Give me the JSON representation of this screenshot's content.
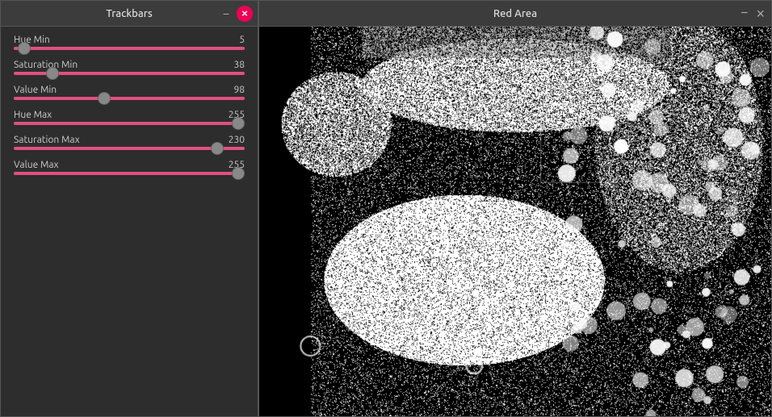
{
  "trackbars": {
    "title": "Trackbars",
    "minimize_label": "−",
    "close_label": "×",
    "sliders": [
      {
        "id": "hue-min",
        "label": "Hue Min",
        "value": 5,
        "min": 0,
        "max": 255,
        "percent": 1.96
      },
      {
        "id": "saturation-min",
        "label": "Saturation Min",
        "value": 38,
        "min": 0,
        "max": 255,
        "percent": 14.9
      },
      {
        "id": "value-min",
        "label": "Value Min",
        "value": 98,
        "min": 0,
        "max": 255,
        "percent": 38.4
      },
      {
        "id": "hue-max",
        "label": "Hue Max",
        "value": 255,
        "min": 0,
        "max": 255,
        "percent": 100
      },
      {
        "id": "saturation-max",
        "label": "Saturation Max",
        "value": 230,
        "min": 0,
        "max": 255,
        "percent": 90.2
      },
      {
        "id": "value-max",
        "label": "Value Max",
        "value": 255,
        "min": 0,
        "max": 255,
        "percent": 100
      }
    ]
  },
  "red_area": {
    "title": "Red Area",
    "minimize_label": "−",
    "close_label": "×"
  },
  "colors": {
    "accent": "#e05080",
    "thumb": "#888888",
    "panel_bg": "#2d2d2d",
    "titlebar_bg": "#3c3c3c"
  }
}
